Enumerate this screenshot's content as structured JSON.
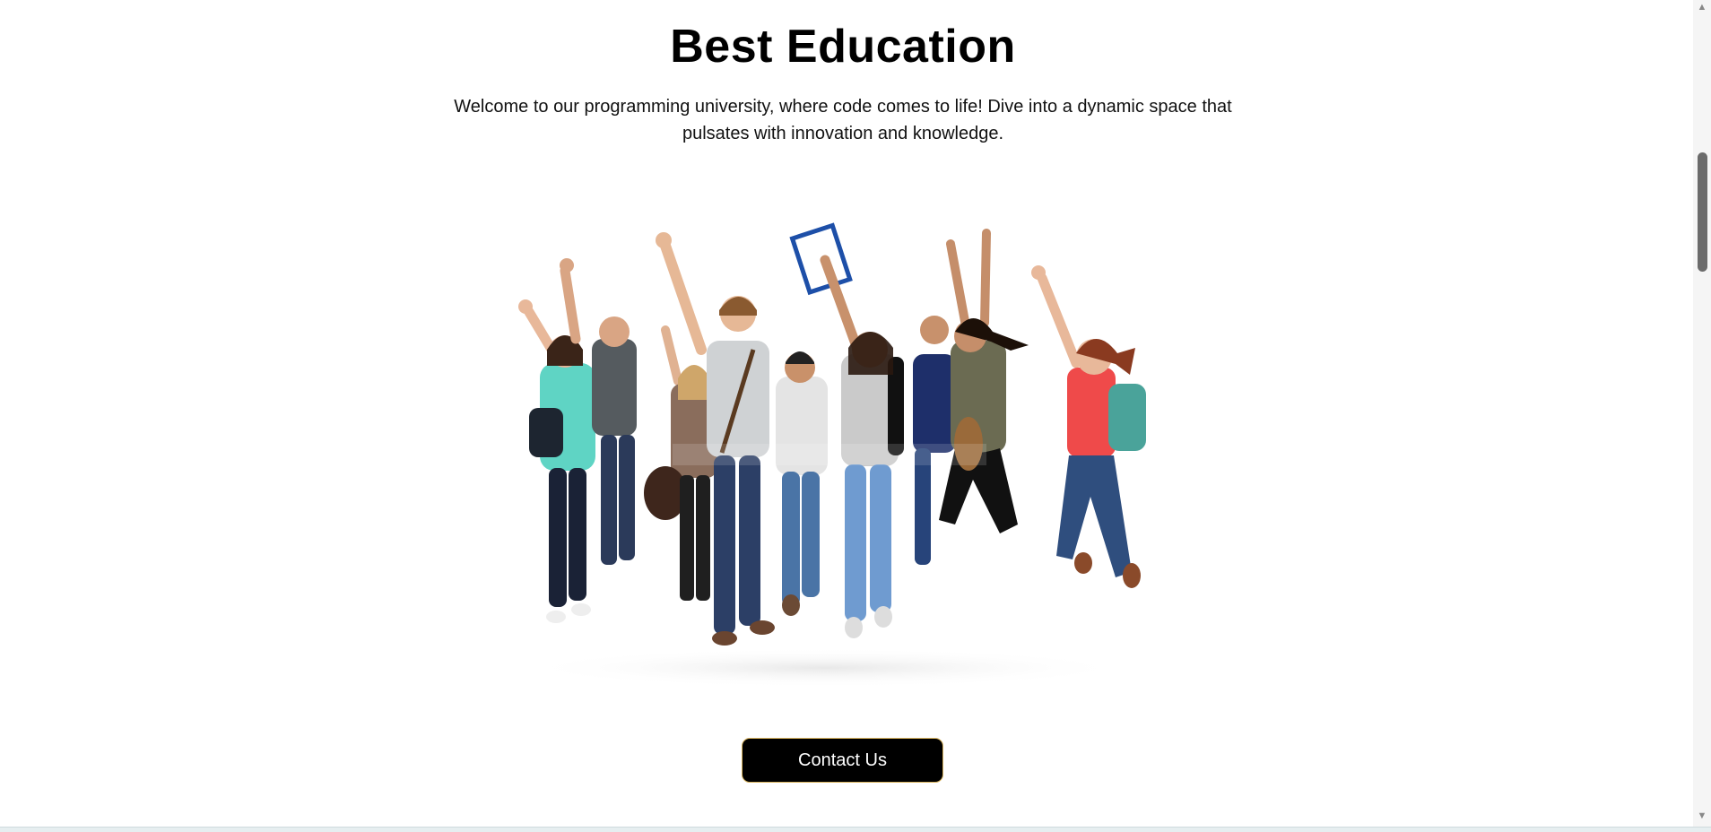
{
  "hero": {
    "title": "Best Education",
    "intro": "Welcome to our programming university, where code comes to life! Dive into a dynamic space that pulsates with innovation and knowledge.",
    "image_alt_icon": "group-of-jumping-students-photo"
  },
  "contact_button": {
    "label": "Contact Us"
  },
  "colors": {
    "button_bg": "#000000",
    "button_text": "#ffffff",
    "button_border": "#d6b25e",
    "background": "#ffffff"
  },
  "scroll": {
    "position_fraction": 0.2
  }
}
